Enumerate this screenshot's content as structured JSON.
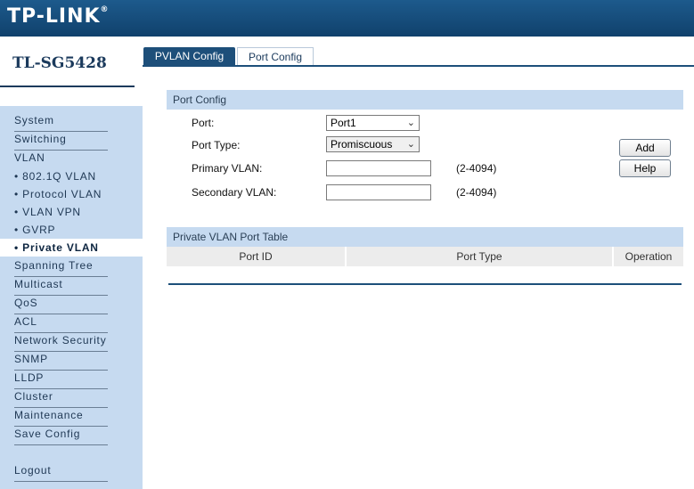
{
  "header": {
    "brand": "TP-LINK",
    "registered_mark": "®"
  },
  "sidebar": {
    "model": "TL-SG5428",
    "items": [
      {
        "label": "System"
      },
      {
        "label": "Switching"
      },
      {
        "label": "VLAN"
      },
      {
        "label": "• 802.1Q VLAN"
      },
      {
        "label": "• Protocol VLAN"
      },
      {
        "label": "• VLAN VPN"
      },
      {
        "label": "• GVRP"
      },
      {
        "label": "• Private VLAN"
      },
      {
        "label": "Spanning Tree"
      },
      {
        "label": "Multicast"
      },
      {
        "label": "QoS"
      },
      {
        "label": "ACL"
      },
      {
        "label": "Network Security"
      },
      {
        "label": "SNMP"
      },
      {
        "label": "LLDP"
      },
      {
        "label": "Cluster"
      },
      {
        "label": "Maintenance"
      },
      {
        "label": "Save Config"
      },
      {
        "label": "Logout"
      }
    ],
    "active_item": "• Private VLAN"
  },
  "tabs": [
    {
      "label": "PVLAN Config",
      "active": false
    },
    {
      "label": "Port Config",
      "active": true
    }
  ],
  "port_config": {
    "title": "Port Config",
    "port_label": "Port:",
    "port_value": "Port1",
    "port_type_label": "Port Type:",
    "port_type_value": "Promiscuous",
    "primary_vlan_label": "Primary VLAN:",
    "primary_vlan_value": "",
    "primary_vlan_hint": "(2-4094)",
    "secondary_vlan_label": "Secondary VLAN:",
    "secondary_vlan_value": "",
    "secondary_vlan_hint": "(2-4094)",
    "add_button": "Add",
    "help_button": "Help"
  },
  "port_table": {
    "title": "Private VLAN Port Table",
    "columns": [
      "Port ID",
      "Port Type",
      "Operation"
    ],
    "rows": []
  },
  "colors": {
    "header": "#10416c",
    "sidebar_menu_bg": "#c6daf0",
    "tab_active_bg": "#1d4f7a"
  }
}
